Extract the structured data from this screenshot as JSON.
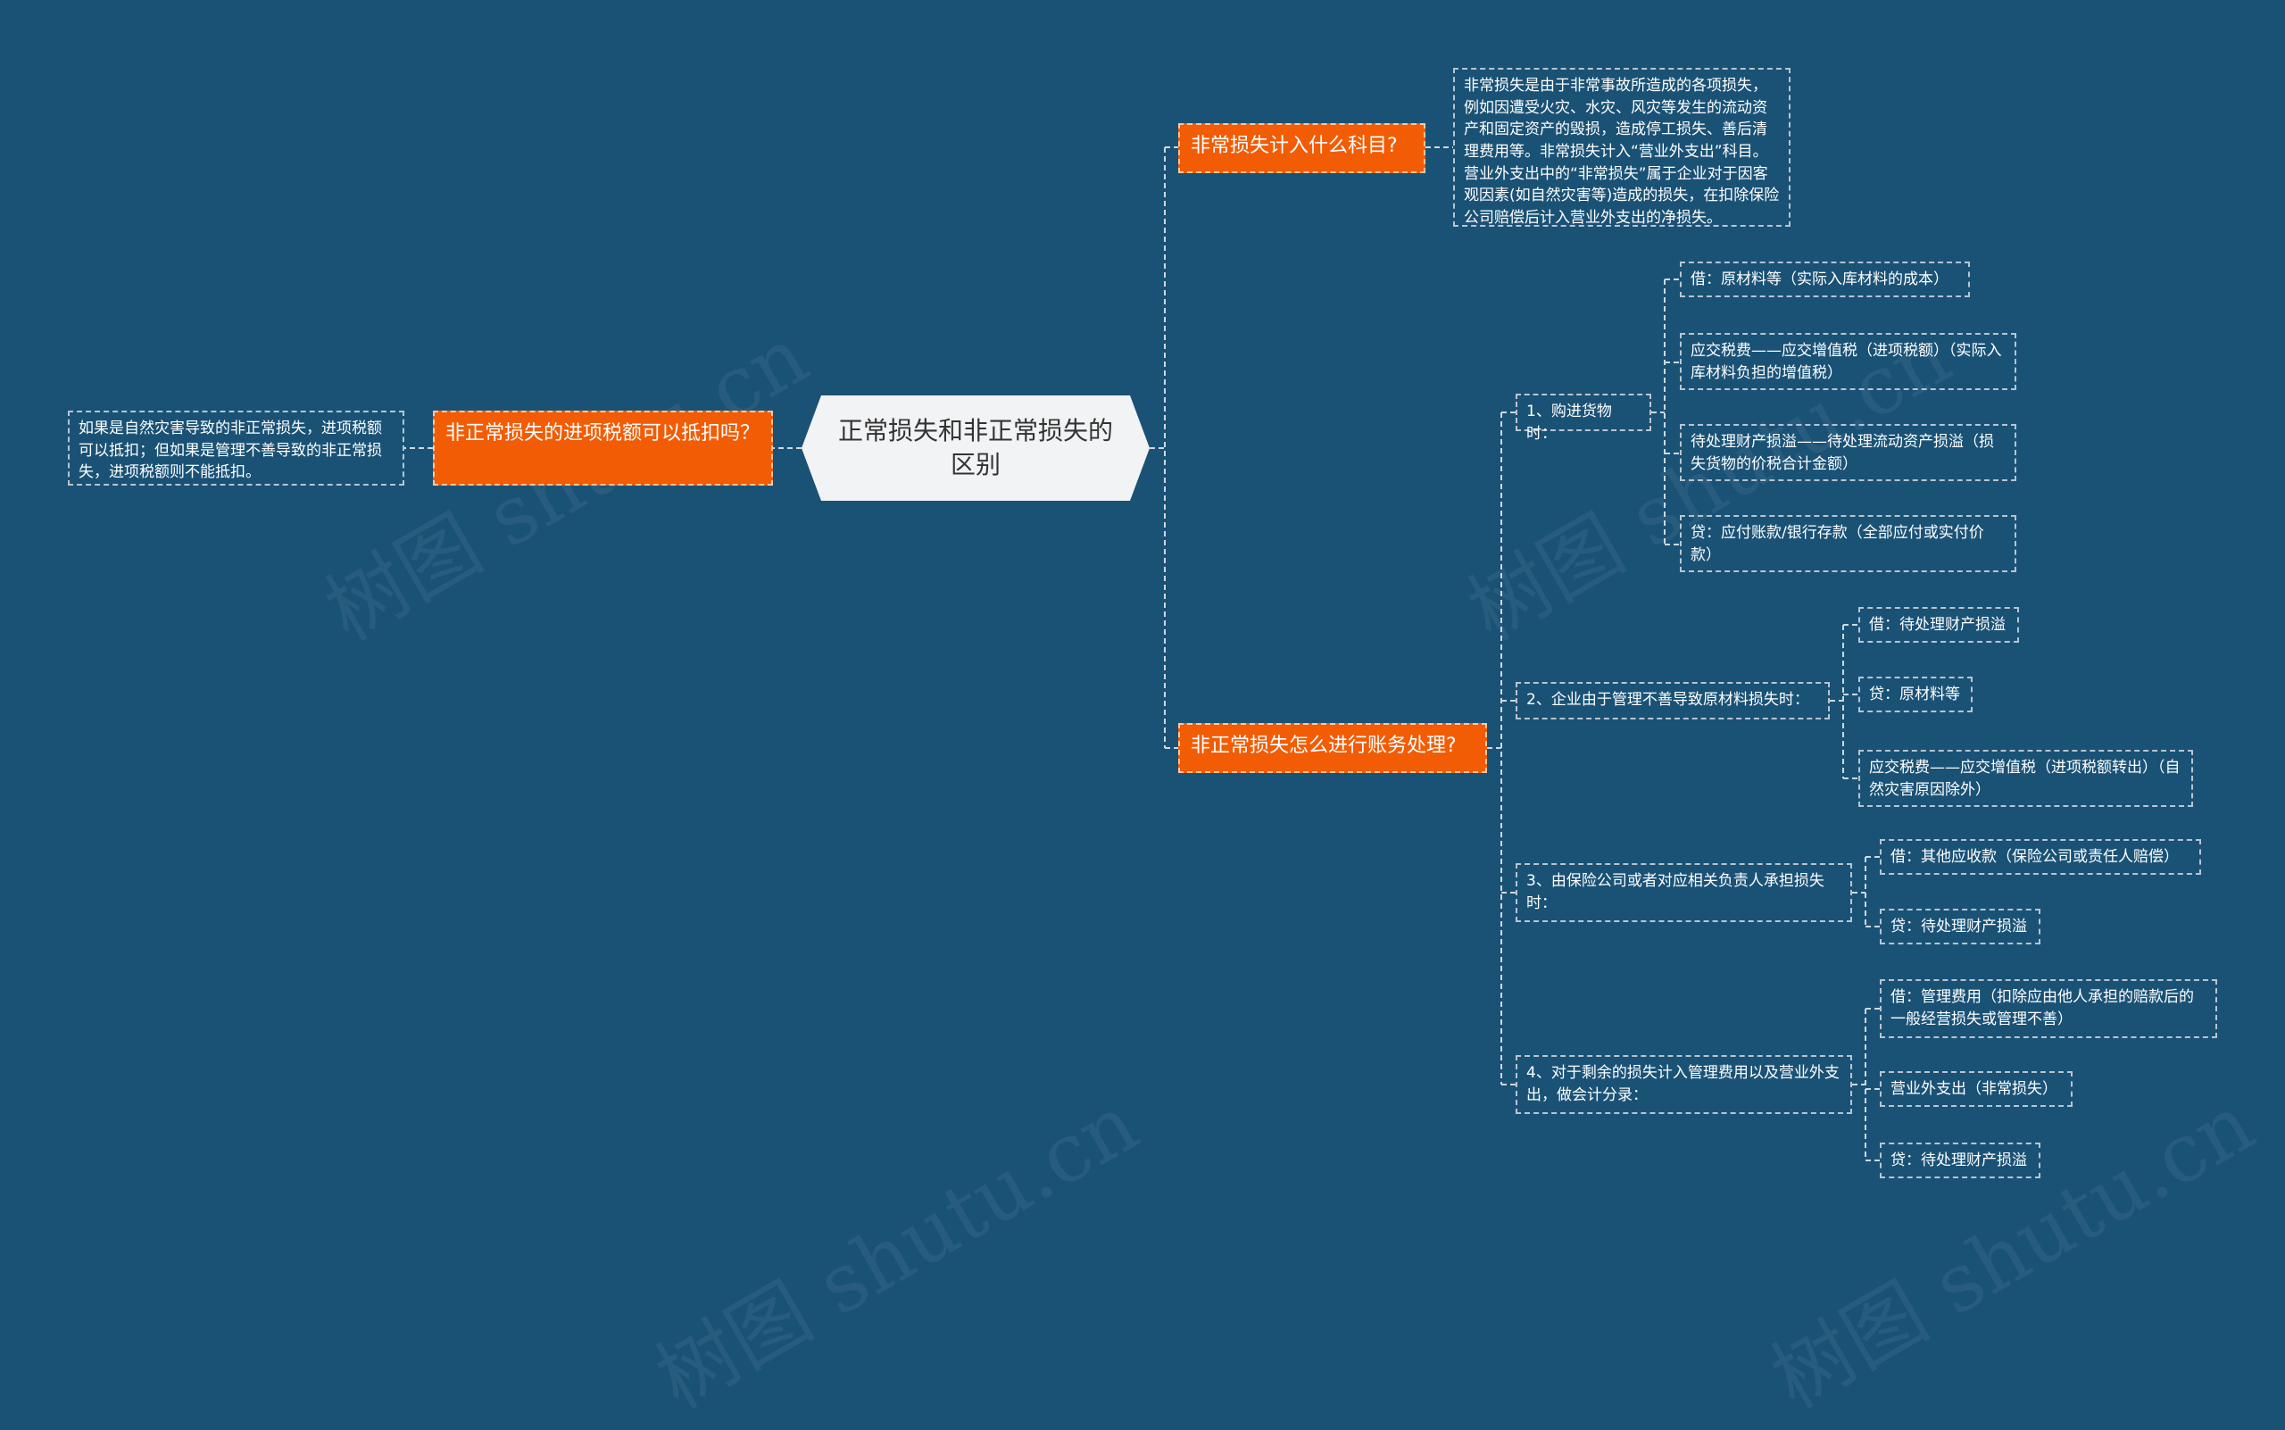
{
  "center": "正常损失和非正常损失的区别",
  "left_branch": {
    "label": "非正常损失的进项税额可以抵扣吗？",
    "note": "如果是自然灾害导致的非正常损失，进项税额可以抵扣；但如果是管理不善导致的非正常损失，进项税额则不能抵扣。"
  },
  "top_branch": {
    "label": "非常损失计入什么科目?",
    "note": "非常损失是由于非常事故所造成的各项损失，例如因遭受火灾、水灾、风灾等发生的流动资产和固定资产的毁损，造成停工损失、善后清理费用等。非常损失计入“营业外支出”科目。营业外支出中的“非常损失”属于企业对于因客观因素(如自然灾害等)造成的损失，在扣除保险公司赔偿后计入营业外支出的净损失。"
  },
  "bottom_branch": {
    "label": "非正常损失怎么进行账务处理?",
    "steps": [
      {
        "label": "1、购进货物时：",
        "items": [
          "借：原材料等（实际入库材料的成本）",
          "应交税费——应交增值税（进项税额）（实际入库材料负担的增值税）",
          "待处理财产损溢——待处理流动资产损溢（损失货物的价税合计金额）",
          "贷：应付账款/银行存款（全部应付或实付价款）"
        ]
      },
      {
        "label": "2、企业由于管理不善导致原材料损失时：",
        "items": [
          "借：待处理财产损溢",
          "贷：原材料等",
          "应交税费——应交增值税（进项税额转出）（自然灾害原因除外）"
        ]
      },
      {
        "label": "3、由保险公司或者对应相关负责人承担损失时：",
        "items": [
          "借：其他应收款（保险公司或责任人赔偿）",
          "贷：待处理财产损溢"
        ]
      },
      {
        "label": "4、对于剩余的损失计入管理费用以及营业外支出，做会计分录：",
        "items": [
          "借：管理费用（扣除应由他人承担的赔款后的一般经营损失或管理不善）",
          "营业外支出（非常损失）",
          "贷：待处理财产损溢"
        ]
      }
    ]
  },
  "watermark": "树图 shutu.cn"
}
